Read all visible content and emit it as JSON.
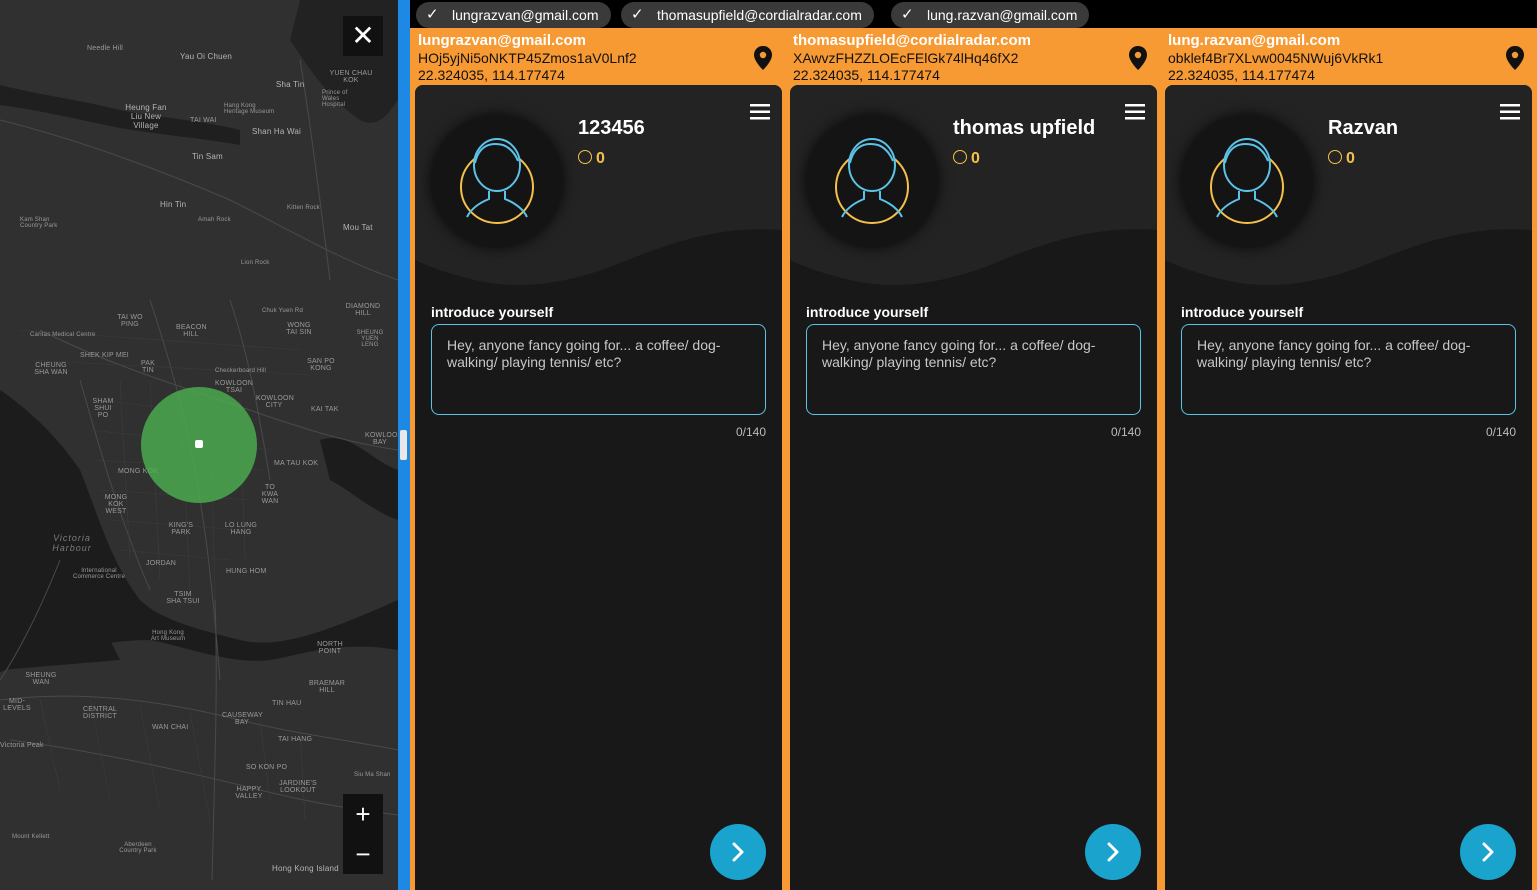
{
  "map": {
    "close_label": "✕",
    "zoom_in_label": "+",
    "zoom_out_label": "−",
    "labels": {
      "needle_hill": "Needle Hill",
      "yau_oi_chuen": "Yau Oi Chuen",
      "sha_tin": "Sha Tin",
      "yuen_chau_kok": "YUEN CHAU KOK",
      "prince_of_wales": "Prince of Wales Hospital",
      "heung_fan_liu": "Heung Fan Liu New Village",
      "hang_kong": "Hang Kong Heritage Museum",
      "tai_wai": "TAI WAI",
      "shan_ha_wai": "Shan Ha Wai",
      "tin_sam": "Tin Sam",
      "hin_tin": "Hin Tin",
      "kam_shan": "Kam Shan Country Park",
      "amah_rock": "Amah Rock",
      "kitten_rock": "Kitten Rock",
      "mou_tat": "Mou Tat",
      "lion_rock": "Lion Rock",
      "diamond_hill": "DIAMOND HILL",
      "tai_wo_ping": "TAI WO PING",
      "beacon_hill": "BEACON HILL",
      "chuk_yuen": "Chuk Yuen Rd",
      "wong_tai_sin": "WONG TAI SIN",
      "shek_kip_mei": "SHEK KIP MEI",
      "shun_lee": "SHEUNG YUEN LENG",
      "caritas": "Caritas Medical Centre",
      "checkerboard": "Checkerboard Hill",
      "cheung_sha_wan": "CHEUNG SHA WAN",
      "pak_tin": "PAK TIN",
      "kowloon_tsai": "KOWLOON TSAI",
      "san_po_kong": "SAN PO KONG",
      "sham_shui_po": "SHAM SHUI PO",
      "kowloon_city": "KOWLOON CITY",
      "kai_tak": "KAI TAK",
      "ma_tau_kok": "MA TAU KOK",
      "kowloon_bay": "KOWLOON BAY",
      "mong_kok": "MONG KOK",
      "mong_kok_west": "MONG KOK WEST",
      "to_kwa_wan": "TO KWA WAN",
      "kings_park": "KING'S PARK",
      "lo_lung_hang": "LO LUNG HANG",
      "victoria_harbour": "Victoria Harbour",
      "jordan": "JORDAN",
      "hung_hom": "HUNG HOM",
      "icc": "International Commerce Centre",
      "tsim_sha_tsui": "TSIM SHA TSUI",
      "hk_art_museum": "Hong Kong Art Museum",
      "north_point": "NORTH POINT",
      "braemar_hill": "BRAEMAR HILL",
      "sheung_wan": "SHEUNG WAN",
      "central": "CENTRAL DISTRICT",
      "mid_levels": "MID-LEVELS",
      "wan_chai": "WAN CHAI",
      "causeway_bay": "CAUSEWAY BAY",
      "tin_hau": "TIN HAU",
      "tai_hang": "TAI HANG",
      "victoria_peak": "Victoria Peak",
      "so_kon_po": "SO KON PO",
      "happy_valley": "HAPPY VALLEY",
      "jardines": "JARDINE'S LOOKOUT",
      "siu_ma_shan": "Siu Ma Shan",
      "mount_kellett": "Mount Kellett",
      "aberdeen": "Aberdeen Country Park",
      "hk_island": "Hong Kong Island"
    }
  },
  "tabs": [
    {
      "label": "lungrazvan@gmail.com"
    },
    {
      "label": "thomasupfield@cordialradar.com"
    },
    {
      "label": "lung.razvan@gmail.com"
    }
  ],
  "users": [
    {
      "email": "lungrazvan@gmail.com",
      "uid": "HOj5yjNi5oNKTP45Zmos1aV0Lnf2",
      "coords": "22.324035, 114.177474",
      "name": "123456",
      "score": "0",
      "intro_label": "introduce yourself",
      "intro_placeholder": "Hey, anyone fancy going for... a coffee/ dog-walking/ playing tennis/ etc?",
      "counter": "0/140"
    },
    {
      "email": "thomasupfield@cordialradar.com",
      "uid": "XAwvzFHZZLOEcFElGk74lHq46fX2",
      "coords": "22.324035, 114.177474",
      "name": "thomas upfield",
      "score": "0",
      "intro_label": "introduce yourself",
      "intro_placeholder": "Hey, anyone fancy going for... a coffee/ dog-walking/ playing tennis/ etc?",
      "counter": "0/140"
    },
    {
      "email": "lung.razvan@gmail.com",
      "uid": "obklef4Br7XLvw0045NWuj6VkRk1",
      "coords": "22.324035, 114.177474",
      "name": "Razvan",
      "score": "0",
      "intro_label": "introduce yourself",
      "intro_placeholder": "Hey, anyone fancy going for... a coffee/ dog-walking/ playing tennis/ etc?",
      "counter": "0/140"
    }
  ],
  "colors": {
    "header_bg": "#f79a33",
    "card_bg": "#181818",
    "accent_blue": "#1aa3cc",
    "divider": "#1e88e5",
    "radius_green": "#4caf50",
    "score_gold": "#f5c04a"
  },
  "icons": {
    "tab_check": "check-icon",
    "pin": "location-pin-icon",
    "menu": "hamburger-menu-icon",
    "avatar": "person-outline-icon",
    "score": "clock-icon",
    "next": "chevron-right-icon"
  }
}
